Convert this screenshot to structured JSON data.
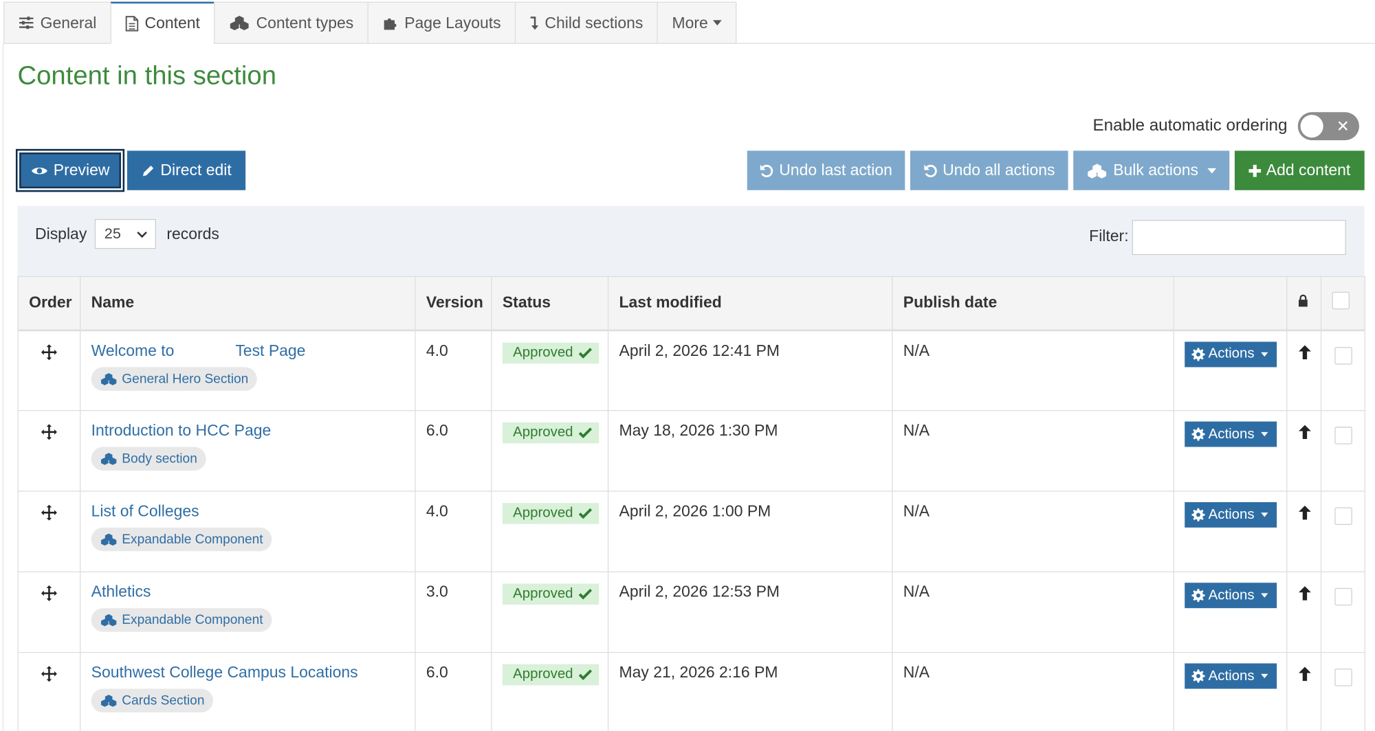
{
  "tabs": [
    {
      "label": "General",
      "icon": "sliders-icon"
    },
    {
      "label": "Content",
      "icon": "document-icon",
      "active": true
    },
    {
      "label": "Content types",
      "icon": "cubes-icon"
    },
    {
      "label": "Page Layouts",
      "icon": "puzzle-icon"
    },
    {
      "label": "Child sections",
      "icon": "level-down-icon"
    },
    {
      "label": "More",
      "icon": "caret-down-icon"
    }
  ],
  "page": {
    "title": "Content in this section"
  },
  "auto_ordering": {
    "label": "Enable automatic ordering",
    "enabled": false
  },
  "toolbar": {
    "preview": "Preview",
    "direct_edit": "Direct edit",
    "undo_last": "Undo last action",
    "undo_all": "Undo all actions",
    "bulk_actions": "Bulk actions",
    "add_content": "Add content"
  },
  "display": {
    "label": "Display",
    "value": "25",
    "suffix": "records"
  },
  "filter": {
    "label": "Filter:",
    "value": ""
  },
  "table": {
    "headers": [
      "Order",
      "Name",
      "Version",
      "Status",
      "Last modified",
      "Publish date"
    ],
    "rows": [
      {
        "name": "Welcome to              Test Page",
        "type": "General Hero Section",
        "version": "4.0",
        "status": "Approved",
        "modified": "April 2, 2026 12:41 PM",
        "publish": "N/A",
        "action": "Actions"
      },
      {
        "name": "Introduction to HCC Page",
        "type": "Body section",
        "version": "6.0",
        "status": "Approved",
        "modified": "May 18, 2026 1:30 PM",
        "publish": "N/A",
        "action": "Actions"
      },
      {
        "name": "List of Colleges",
        "type": "Expandable Component",
        "version": "4.0",
        "status": "Approved",
        "modified": "April 2, 2026 1:00 PM",
        "publish": "N/A",
        "action": "Actions"
      },
      {
        "name": "Athletics",
        "type": "Expandable Component",
        "version": "3.0",
        "status": "Approved",
        "modified": "April 2, 2026 12:53 PM",
        "publish": "N/A",
        "action": "Actions"
      },
      {
        "name": "Southwest College Campus Locations",
        "type": "Cards Section",
        "version": "6.0",
        "status": "Approved",
        "modified": "May 21, 2026 2:16 PM",
        "publish": "N/A",
        "action": "Actions"
      }
    ]
  },
  "colors": {
    "primary": "#2e6da4",
    "light_primary": "#7fa9cc",
    "success": "#3c8a3c",
    "title_green": "#3d8b3d",
    "approved_bg": "#d9f0d9"
  }
}
